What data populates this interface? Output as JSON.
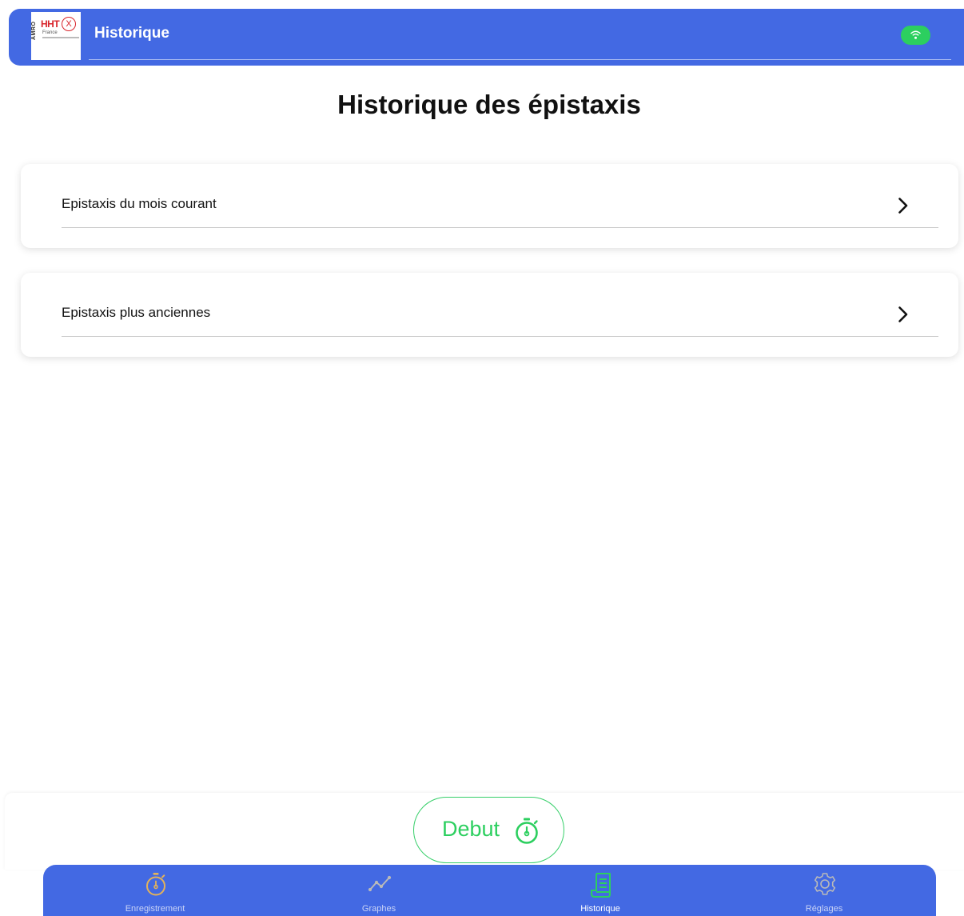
{
  "header": {
    "title": "Historique",
    "logo": {
      "brand": "HHT",
      "country": "France",
      "side_text": "AMRO",
      "symbol": "X"
    },
    "status_icon": "wifi-icon",
    "status_color": "#2ccf5f"
  },
  "page": {
    "title": "Historique des épistaxis"
  },
  "list": {
    "items": [
      {
        "label": "Epistaxis du mois courant",
        "icon": "chevron-right-icon"
      },
      {
        "label": "Epistaxis plus anciennes",
        "icon": "chevron-right-icon"
      }
    ]
  },
  "action": {
    "debut_label": "Debut",
    "debut_icon": "stopwatch-icon",
    "color": "#2ccf5f"
  },
  "tabbar": {
    "background": "#4369e3",
    "tabs": [
      {
        "label": "Enregistrement",
        "icon": "stopwatch-icon",
        "color": "#e3b25a",
        "active": false
      },
      {
        "label": "Graphes",
        "icon": "chart-line-icon",
        "color": "#b9b9b9",
        "active": false
      },
      {
        "label": "Historique",
        "icon": "scroll-icon",
        "color": "#2ccf5f",
        "active": true
      },
      {
        "label": "Réglages",
        "icon": "gear-icon",
        "color": "#b9b9b9",
        "active": false
      }
    ]
  }
}
